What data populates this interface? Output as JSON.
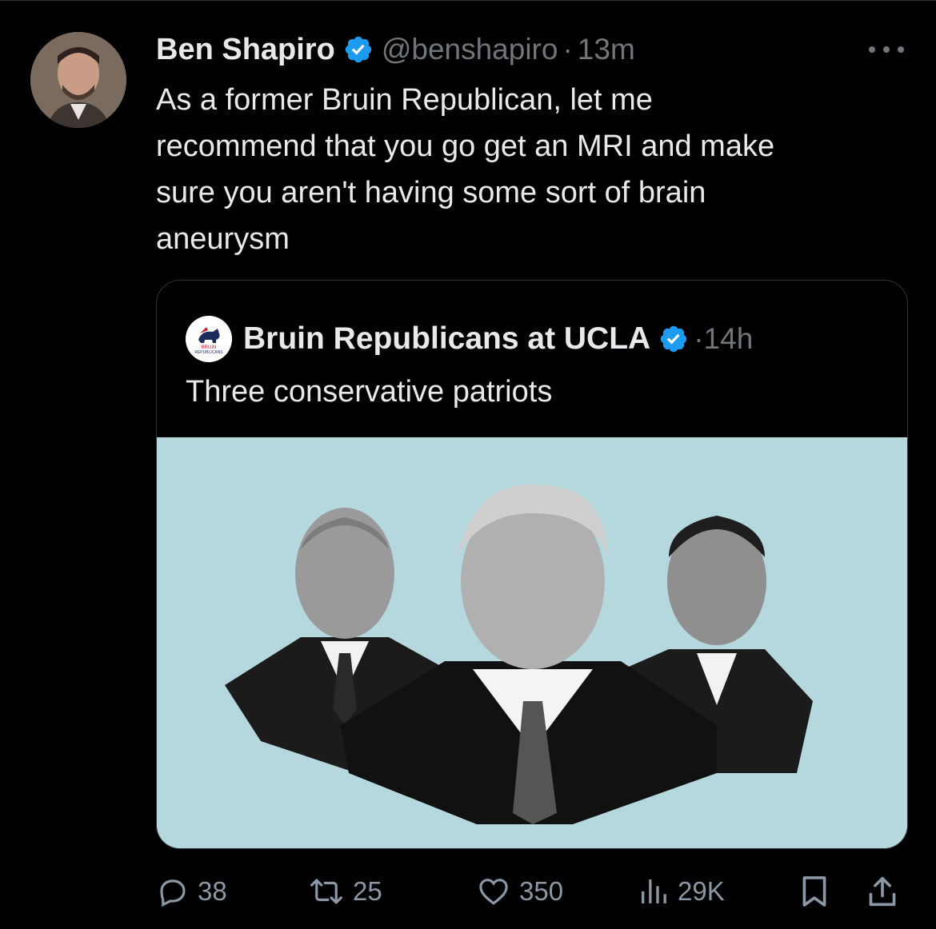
{
  "tweet": {
    "author_name": "Ben Shapiro",
    "handle": "@benshapiro",
    "separator": "·",
    "time": "13m",
    "text": "As a former Bruin Republican, let me\nrecommend that you go get an MRI and make\nsure you aren't having some sort of brain\naneurysm"
  },
  "quoted": {
    "author_name": "Bruin Republicans at UCLA",
    "separator": "·",
    "time": "14h",
    "text": "Three conservative patriots",
    "logo_text_top": "BRUIN",
    "logo_text_bottom": "REPUBLICANS"
  },
  "actions": {
    "replies": "38",
    "reposts": "25",
    "likes": "350",
    "views": "29K"
  },
  "colors": {
    "background": "#000000",
    "text": "#e7e9ea",
    "muted": "#71767b",
    "verified": "#1d9bf0",
    "border": "#2f3336",
    "media_bg": "#b5d8df"
  },
  "icons": [
    "verified-badge-icon",
    "more-icon",
    "reply-icon",
    "repost-icon",
    "like-icon",
    "views-icon",
    "bookmark-icon",
    "share-icon"
  ]
}
